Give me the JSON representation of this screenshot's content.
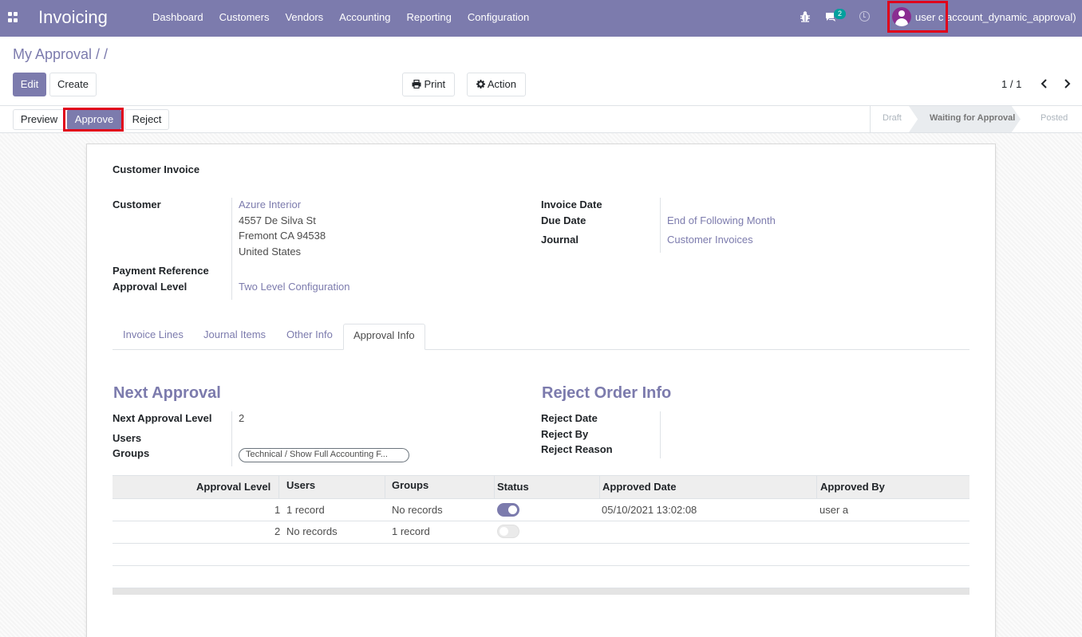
{
  "navbar": {
    "app_title": "Invoicing",
    "menu": [
      "Dashboard",
      "Customers",
      "Vendors",
      "Accounting",
      "Reporting",
      "Configuration"
    ],
    "chat_count": "2",
    "user_name": "user c  account_dynamic_approval)",
    "colors": {
      "bar": "#7c7bad",
      "badge": "#00a09d",
      "highlight": "#e0001b"
    }
  },
  "breadcrumb": "My Approval / /",
  "buttons": {
    "edit": "Edit",
    "create": "Create",
    "print": "Print",
    "action": "Action"
  },
  "pager": "1 / 1",
  "statusbar": {
    "preview": "Preview",
    "approve": "Approve",
    "reject": "Reject",
    "stages": [
      "Draft",
      "Waiting for Approval",
      "Posted"
    ],
    "current_stage": "Waiting for Approval"
  },
  "form": {
    "title": "Customer Invoice",
    "customer_label": "Customer",
    "customer_name": "Azure Interior",
    "address": [
      "4557 De Silva St",
      "Fremont CA 94538",
      "United States"
    ],
    "payment_reference_label": "Payment Reference",
    "approval_level_label": "Approval Level",
    "approval_level_value": "Two Level Configuration",
    "invoice_date_label": "Invoice Date",
    "due_date_label": "Due Date",
    "due_date_value": "End of Following Month",
    "journal_label": "Journal",
    "journal_value": "Customer Invoices"
  },
  "tabs": [
    "Invoice Lines",
    "Journal Items",
    "Other Info",
    "Approval Info"
  ],
  "active_tab": "Approval Info",
  "approval_info": {
    "next_title": "Next Approval",
    "next_level_label": "Next Approval Level",
    "next_level_value": "2",
    "users_label": "Users",
    "groups_label": "Groups",
    "groups_tag": "Technical / Show Full Accounting F...",
    "reject_title": "Reject Order Info",
    "reject_date_label": "Reject Date",
    "reject_by_label": "Reject By",
    "reject_reason_label": "Reject Reason"
  },
  "table": {
    "headers": [
      "Approval Level",
      "Users",
      "Groups",
      "Status",
      "Approved Date",
      "Approved By"
    ],
    "rows": [
      {
        "level": "1",
        "users": "1 record",
        "groups": "No records",
        "status": true,
        "date": "05/10/2021 13:02:08",
        "by": "user a"
      },
      {
        "level": "2",
        "users": "No records",
        "groups": "1 record",
        "status": false,
        "date": "",
        "by": ""
      }
    ]
  }
}
